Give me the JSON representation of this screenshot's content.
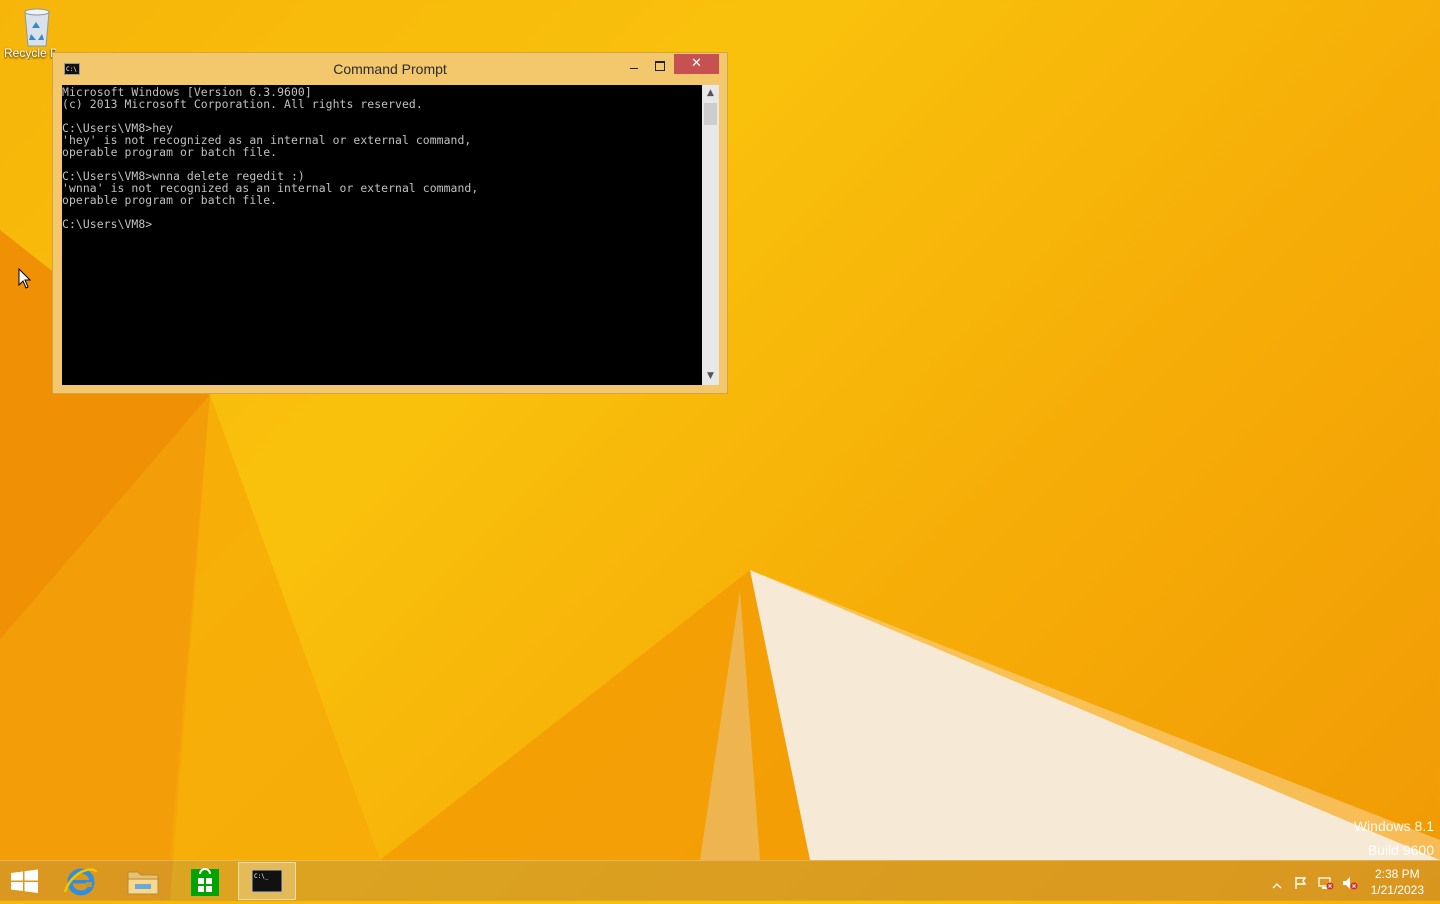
{
  "desktop": {
    "recycle_bin_label": "Recycle Bin"
  },
  "window": {
    "title": "Command Prompt",
    "close_glyph": "✕",
    "console_lines": [
      "Microsoft Windows [Version 6.3.9600]",
      "(c) 2013 Microsoft Corporation. All rights reserved.",
      "",
      "C:\\Users\\VM8>hey",
      "'hey' is not recognized as an internal or external command,",
      "operable program or batch file.",
      "",
      "C:\\Users\\VM8>wnna delete regedit :)",
      "'wnna' is not recognized as an internal or external command,",
      "operable program or batch file.",
      "",
      "C:\\Users\\VM8>"
    ],
    "scroll_up_glyph": "▲",
    "scroll_down_glyph": "▼"
  },
  "watermark": {
    "line1": "Windows 8.1",
    "line2": "Build 9600"
  },
  "taskbar": {
    "items": [
      {
        "name": "start-icon"
      },
      {
        "name": "internet-explorer-icon"
      },
      {
        "name": "file-explorer-icon"
      },
      {
        "name": "store-icon"
      },
      {
        "name": "command-prompt-icon",
        "active": true
      }
    ],
    "tray_icon_label": "C:\\_",
    "clock_time": "2:38 PM",
    "clock_date": "1/21/2023"
  },
  "colors": {
    "console_bg": "#000000",
    "console_text": "#c0c0c0",
    "close_button": "#c75050",
    "window_frame": "#f3c76c"
  }
}
